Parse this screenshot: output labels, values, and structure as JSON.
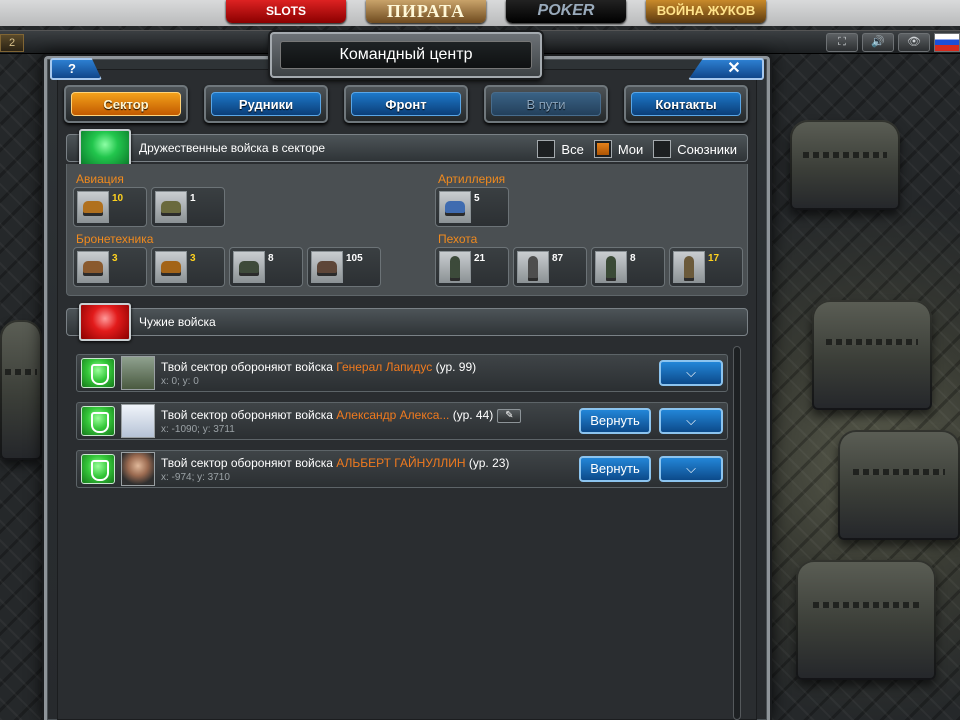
{
  "promos": [
    {
      "id": "slots",
      "label": "SLOTS"
    },
    {
      "id": "pirata",
      "label": "ПИРАТА"
    },
    {
      "id": "poker",
      "label": "POKER"
    },
    {
      "id": "beetles",
      "label": "ВОЙНА ЖУКОВ"
    }
  ],
  "topbar": {
    "counter": "2",
    "fullscreen_icon": "fullscreen-icon",
    "sound_icon": "speaker-icon",
    "view_icon": "eye-icon"
  },
  "window": {
    "title": "Командный центр",
    "help_label": "?",
    "close_label": "✕"
  },
  "tabs": [
    {
      "label": "Сектор",
      "state": "active"
    },
    {
      "label": "Рудники",
      "state": "normal"
    },
    {
      "label": "Фронт",
      "state": "normal"
    },
    {
      "label": "В пути",
      "state": "disabled"
    },
    {
      "label": "Контакты",
      "state": "normal"
    }
  ],
  "friendly": {
    "title": "Дружественные войска в секторе",
    "filters": [
      {
        "label": "Все",
        "checked": false
      },
      {
        "label": "Мои",
        "checked": true
      },
      {
        "label": "Союзники",
        "checked": false
      }
    ],
    "categories": {
      "aviation": {
        "label": "Авиация",
        "units": [
          {
            "count": "10",
            "gold": true
          },
          {
            "count": "1",
            "gold": false
          }
        ]
      },
      "artillery": {
        "label": "Артиллерия",
        "units": [
          {
            "count": "5",
            "gold": false
          }
        ]
      },
      "armor": {
        "label": "Бронетехника",
        "units": [
          {
            "count": "3",
            "gold": true
          },
          {
            "count": "3",
            "gold": true
          },
          {
            "count": "8",
            "gold": false
          },
          {
            "count": "105",
            "gold": false
          }
        ]
      },
      "infantry": {
        "label": "Пехота",
        "units": [
          {
            "count": "21",
            "gold": false
          },
          {
            "count": "87",
            "gold": false
          },
          {
            "count": "8",
            "gold": false
          },
          {
            "count": "17",
            "gold": true
          }
        ]
      }
    }
  },
  "enemy": {
    "title": "Чужие войска"
  },
  "rows": [
    {
      "prefix": "Твой сектор обороняют войска ",
      "name": "Генерал Лапидус",
      "level": " (ур. 99)",
      "coords": "x: 0; y: 0",
      "has_return": false,
      "has_edit": false
    },
    {
      "prefix": "Твой сектор обороняют войска ",
      "name": "Александр Алекса...",
      "level": " (ур. 44)",
      "coords": "x: -1090; y: 3711",
      "has_return": true,
      "has_edit": true
    },
    {
      "prefix": "Твой сектор обороняют войска ",
      "name": "АЛЬБЕРТ ГАЙНУЛЛИН",
      "level": " (ур. 23)",
      "coords": "x: -974; y: 3710",
      "has_return": true,
      "has_edit": false
    }
  ],
  "buttons": {
    "return_label": "Вернуть",
    "expand_icon": "chevron-down-icon",
    "edit_icon": "pencil-icon"
  },
  "colors": {
    "accent_orange": "#f08a1e",
    "tab_blue": "#1d78c9",
    "gold_count": "#ffd21e"
  }
}
